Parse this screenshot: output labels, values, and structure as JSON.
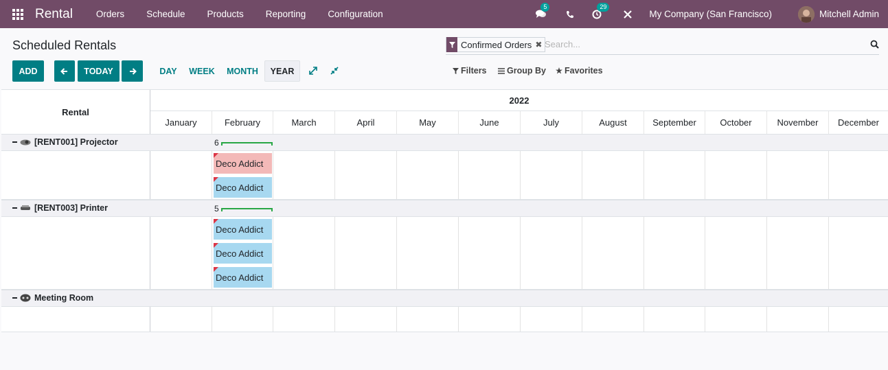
{
  "app": {
    "title": "Rental",
    "menu": [
      "Orders",
      "Schedule",
      "Products",
      "Reporting",
      "Configuration"
    ],
    "messages_count": "5",
    "activities_count": "29",
    "company": "My Company (San Francisco)",
    "user": "Mitchell Admin"
  },
  "control": {
    "page_title": "Scheduled Rentals",
    "add_label": "ADD",
    "today_label": "TODAY",
    "scales": [
      "DAY",
      "WEEK",
      "MONTH",
      "YEAR"
    ],
    "active_scale": "YEAR",
    "facet": "Confirmed Orders",
    "search_placeholder": "Search...",
    "filters_label": "Filters",
    "groupby_label": "Group By",
    "favorites_label": "Favorites"
  },
  "gantt": {
    "rows_header": "Rental",
    "year": "2022",
    "months": [
      "January",
      "February",
      "March",
      "April",
      "May",
      "June",
      "July",
      "August",
      "September",
      "October",
      "November",
      "December"
    ],
    "groups": [
      {
        "name": "[RENT001] Projector",
        "count": "6",
        "pills": [
          {
            "label": "Deco Addict",
            "color": "#f3b9b8"
          },
          {
            "label": "Deco Addict",
            "color": "#a7d8f0"
          }
        ]
      },
      {
        "name": "[RENT003] Printer",
        "count": "5",
        "pills": [
          {
            "label": "Deco Addict",
            "color": "#a7d8f0"
          },
          {
            "label": "Deco Addict",
            "color": "#a7d8f0"
          },
          {
            "label": "Deco Addict",
            "color": "#a7d8f0"
          }
        ]
      },
      {
        "name": "Meeting Room",
        "count": "",
        "pills": []
      }
    ]
  },
  "colors": {
    "navbar": "#714B67",
    "primary_button": "#017E84",
    "badge": "#00A09D",
    "pill_pink": "#f3b9b8",
    "pill_blue": "#a7d8f0",
    "progress_bar": "#28a745"
  }
}
